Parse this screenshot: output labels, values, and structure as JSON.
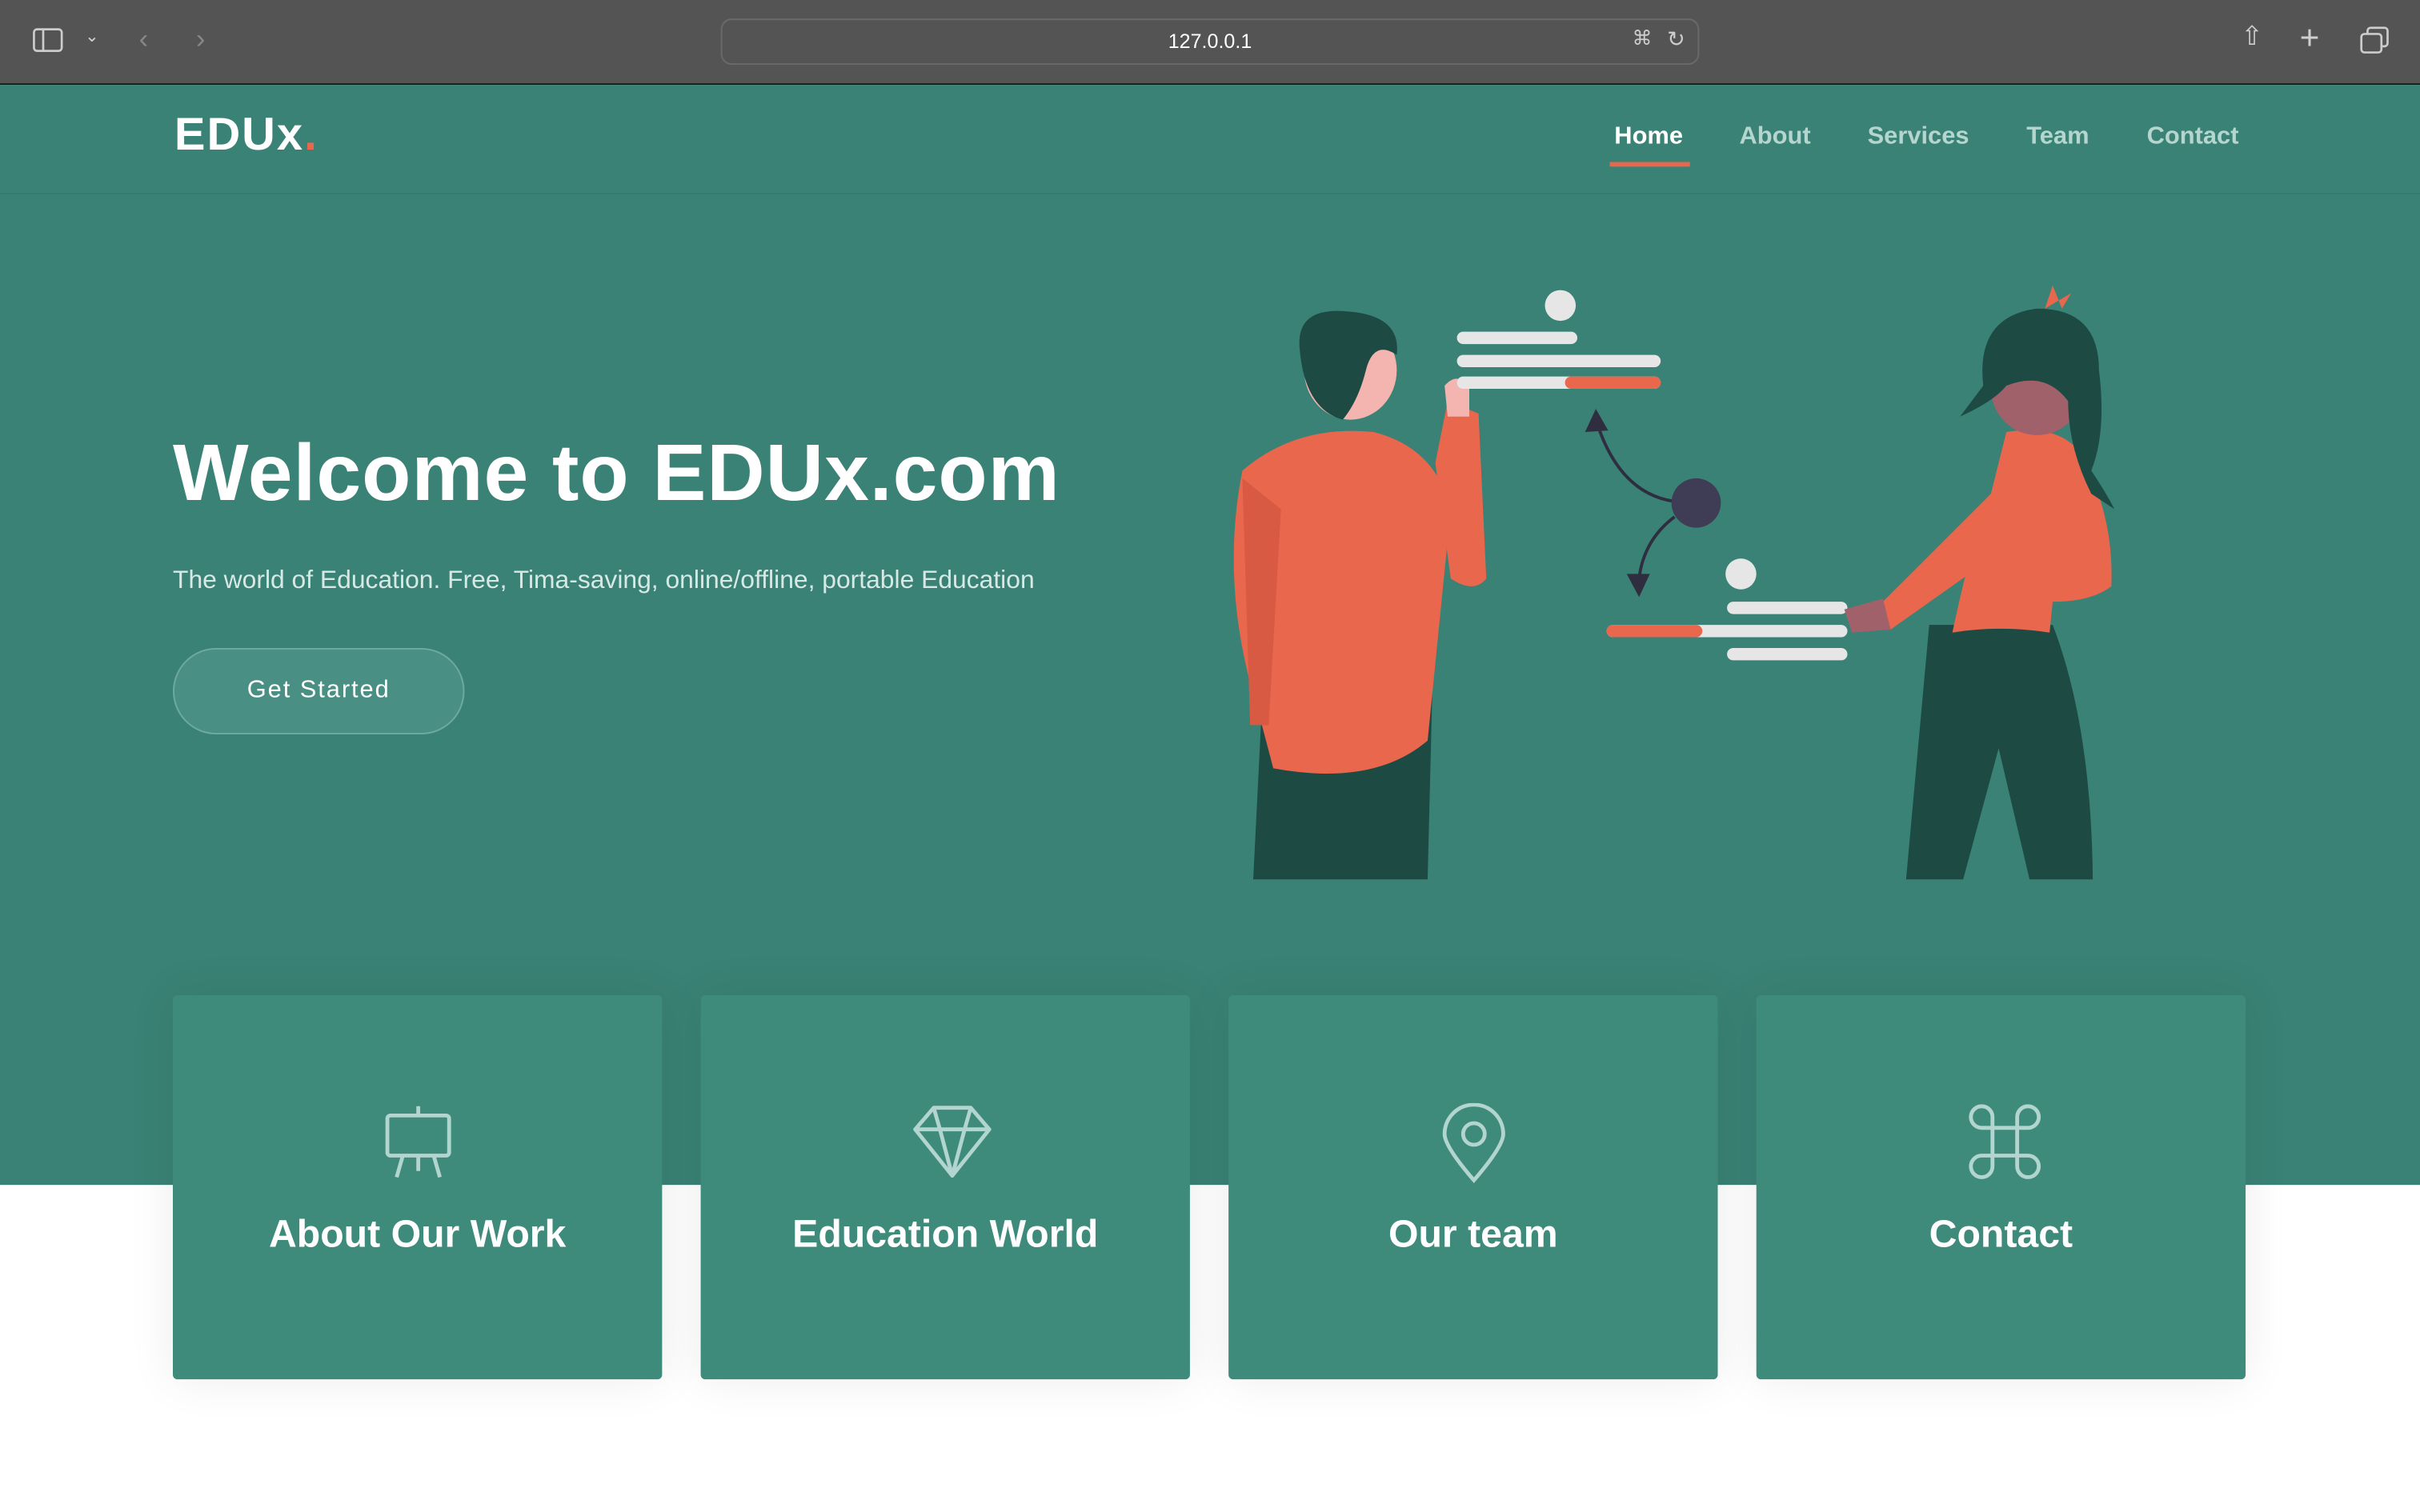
{
  "browser": {
    "url": "127.0.0.1"
  },
  "nav": {
    "logo": "EDUx",
    "logo_dot": ".",
    "items": [
      "Home",
      "About",
      "Services",
      "Team",
      "Contact"
    ],
    "active": "Home"
  },
  "hero": {
    "title": "Welcome to EDUx.com",
    "subtitle": "The world of Education. Free, Tima-saving, online/offline, portable Education",
    "cta": "Get Started"
  },
  "cards": [
    {
      "icon": "easel-icon",
      "title": "About Our Work"
    },
    {
      "icon": "diamond-icon",
      "title": "Education World"
    },
    {
      "icon": "map-pin-icon",
      "title": "Our team"
    },
    {
      "icon": "command-icon",
      "title": "Contact"
    }
  ],
  "colors": {
    "primary": "#3a8275",
    "card": "#3e8b7c",
    "accent": "#e8674d",
    "dark": "#1e4a44"
  }
}
